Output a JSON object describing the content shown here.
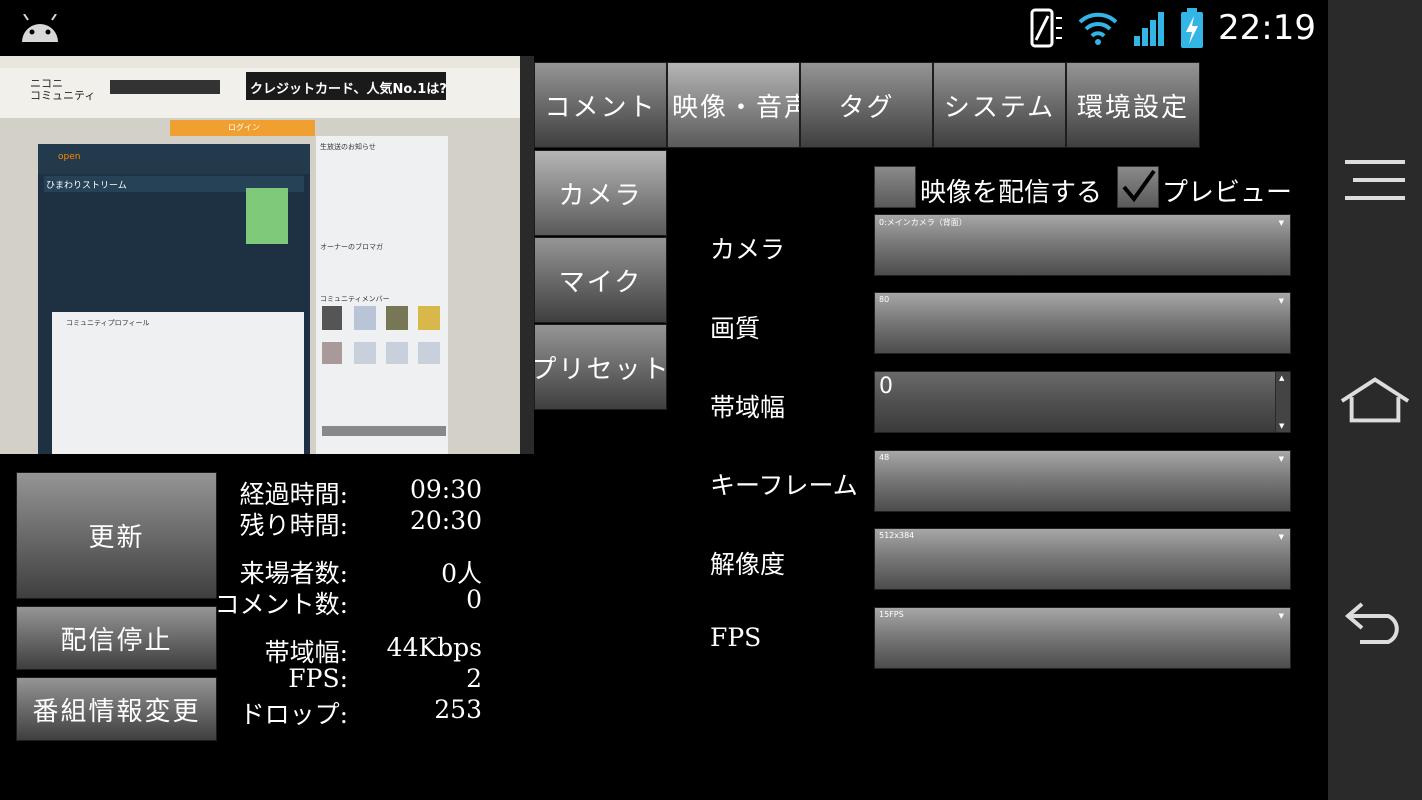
{
  "status_bar": {
    "time": "22:19",
    "icons": [
      "android-icon",
      "vibrate-icon",
      "wifi-icon",
      "signal-icon",
      "battery-charging-icon"
    ]
  },
  "preview": {
    "site_header_line1": "ニコニ",
    "site_header_line2": "コミュニティ",
    "ad_banner": "クレジットカード、人気No.1は?",
    "login_button": "ログイン",
    "community_name": "ひまわりストリーム",
    "panel_title": "open",
    "live_notice": "生放送のお知らせ",
    "owner_blog": "オーナーのブロマガ",
    "members_header": "コミュニティメンバー",
    "profile_header": "コミュニティプロフィール"
  },
  "tabs": {
    "top": [
      "コメント",
      "映像・音声",
      "タグ",
      "システム",
      "環境設定"
    ],
    "active_top": "映像・音声",
    "side": [
      "カメラ",
      "マイク",
      "プリセット"
    ]
  },
  "actions": {
    "update": "更新",
    "stop": "配信停止",
    "info": "番組情報変更"
  },
  "stats": {
    "elapsed_label": "経過時間:",
    "elapsed_value": "09:30",
    "remaining_label": "残り時間:",
    "remaining_value": "20:30",
    "visitors_label": "来場者数:",
    "visitors_value": "0人",
    "comments_label": "コメント数:",
    "comments_value": "0",
    "bandwidth_label": "帯域幅:",
    "bandwidth_value": "44Kbps",
    "fps_label": "FPS:",
    "fps_value": "2",
    "drop_label": "ドロップ:",
    "drop_value": "253"
  },
  "settings": {
    "broadcast_video_label": "映像を配信する",
    "broadcast_video_checked": false,
    "preview_label": "プレビュー",
    "preview_checked": true,
    "camera_label": "カメラ",
    "camera_value": "0:メインカメラ（背面）",
    "quality_label": "画質",
    "quality_value": "80",
    "bandwidth_label": "帯域幅",
    "bandwidth_value": "0",
    "keyframe_label": "キーフレーム",
    "keyframe_value": "48",
    "resolution_label": "解像度",
    "resolution_value": "512x384",
    "fps_label": "FPS",
    "fps_value": "15FPS"
  },
  "colors": {
    "background": "#000000",
    "navbar": "#2a2a2a",
    "battery_accent": "#33b5e5"
  }
}
